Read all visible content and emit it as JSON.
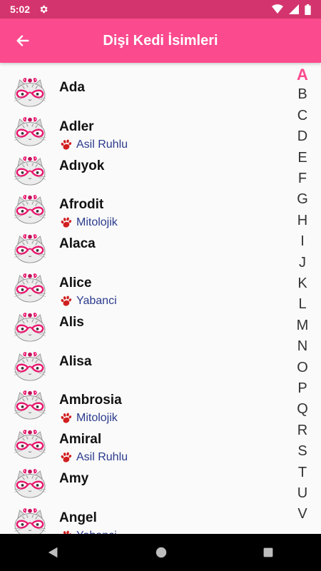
{
  "status_bar": {
    "time": "5:02"
  },
  "app_bar": {
    "title": "Dişi Kedi İsimleri"
  },
  "names": [
    {
      "name": "Ada",
      "category": ""
    },
    {
      "name": "Adler",
      "category": "Asil Ruhlu"
    },
    {
      "name": "Adıyok",
      "category": ""
    },
    {
      "name": "Afrodit",
      "category": "Mitolojik"
    },
    {
      "name": "Alaca",
      "category": ""
    },
    {
      "name": "Alice",
      "category": "Yabanci"
    },
    {
      "name": "Alis",
      "category": ""
    },
    {
      "name": "Alisa",
      "category": ""
    },
    {
      "name": "Ambrosia",
      "category": "Mitolojik"
    },
    {
      "name": "Amiral",
      "category": "Asil Ruhlu"
    },
    {
      "name": "Amy",
      "category": ""
    },
    {
      "name": "Angel",
      "category": "Yabanci"
    }
  ],
  "alphabet": [
    "A",
    "B",
    "C",
    "D",
    "E",
    "F",
    "G",
    "H",
    "I",
    "J",
    "K",
    "L",
    "M",
    "N",
    "O",
    "P",
    "Q",
    "R",
    "S",
    "T",
    "U",
    "V"
  ],
  "active_letter": "A",
  "colors": {
    "accent": "#fb4a8e",
    "status_bar": "#d4346d",
    "category_text": "#2a3a8c",
    "paw": "#d11f1f"
  }
}
